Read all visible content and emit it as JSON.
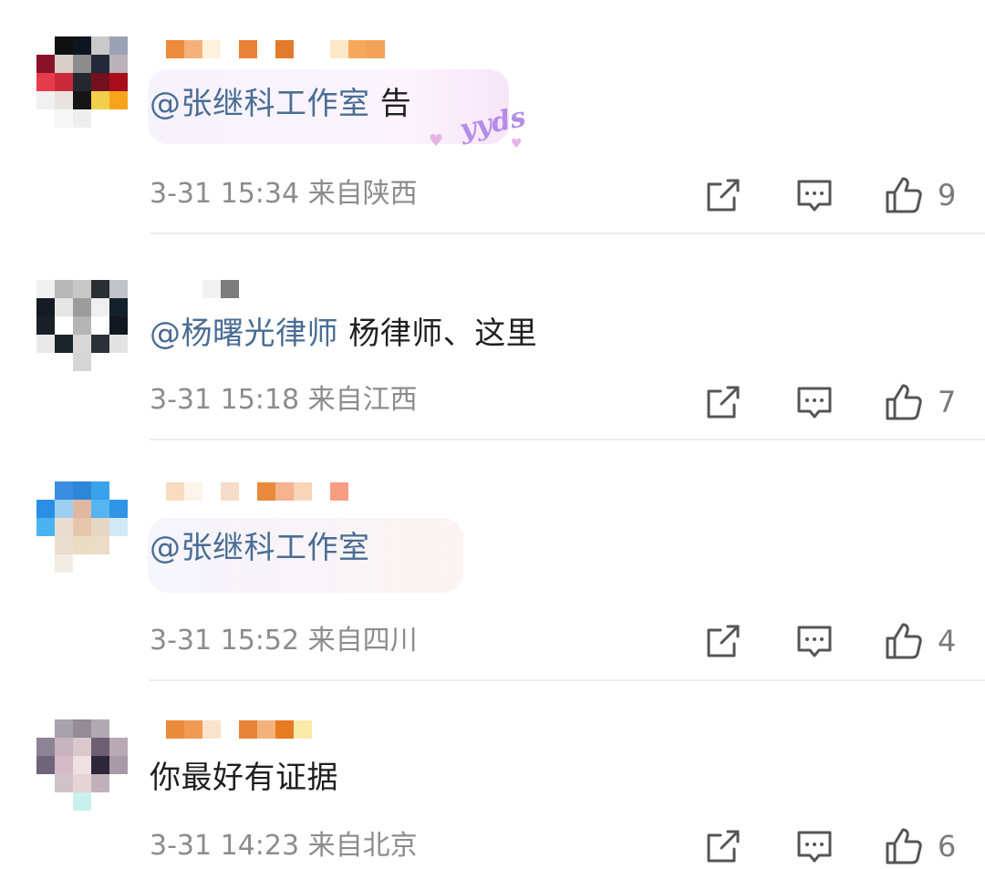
{
  "comments": [
    {
      "mention": "@张继科工作室",
      "text": " 告",
      "time": "3-31 15:34",
      "location": "来自陕西",
      "likes": "9",
      "sticker": "yyds"
    },
    {
      "mention": "@杨曙光律师",
      "text": " 杨律师、这里",
      "time": "3-31 15:18",
      "location": "来自江西",
      "likes": "7"
    },
    {
      "mention": "@张继科工作室",
      "text": "",
      "time": "3-31 15:52",
      "location": "来自四川",
      "likes": "4"
    },
    {
      "mention": "",
      "text": "你最好有证据",
      "time": "3-31 14:23",
      "location": "来自北京",
      "likes": "6"
    }
  ],
  "icons": {
    "share": "share-icon",
    "reply": "comment-icon",
    "like": "thumbs-up-icon"
  },
  "colors": {
    "mention": "#4a6d94",
    "text": "#1f1f1f",
    "meta": "#8c8c8c"
  }
}
